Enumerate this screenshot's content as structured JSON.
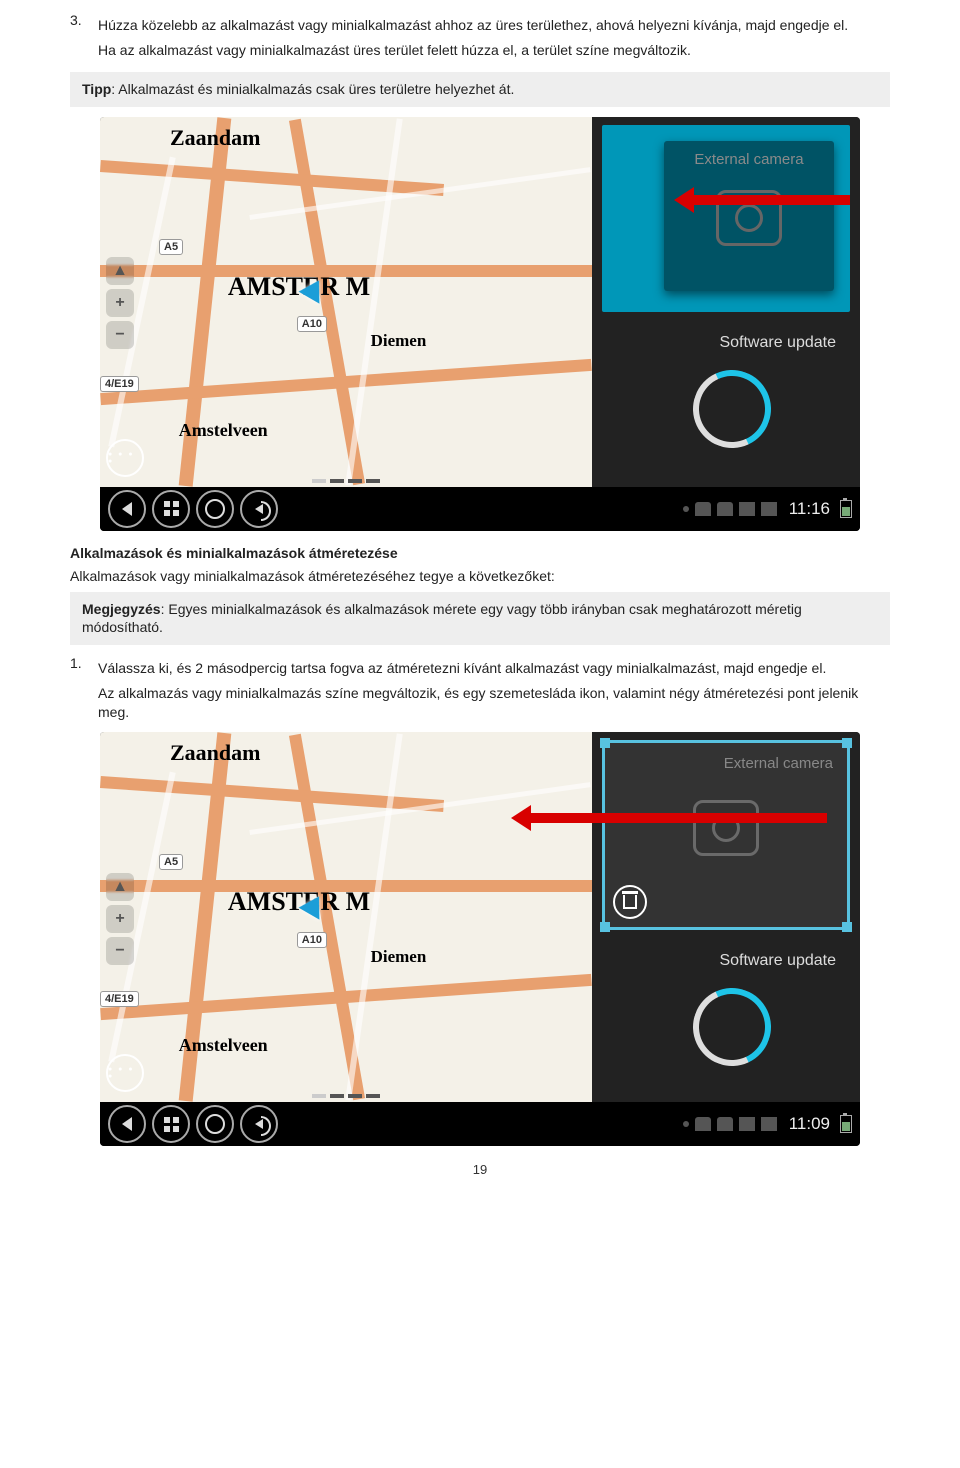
{
  "step3": {
    "num": "3.",
    "text": "Húzza közelebb az alkalmazást vagy minialkalmazást ahhoz az üres területhez, ahová helyezni kívánja, majd engedje el.",
    "sub": "Ha az alkalmazást vagy minialkalmazást üres terület felett húzza el, a terület színe megváltozik."
  },
  "tip": {
    "label": "Tipp",
    "text": ": Alkalmazást és minialkalmazás csak üres területre helyezhet át."
  },
  "section": {
    "title": "Alkalmazások és minialkalmazások átméretezése",
    "intro": "Alkalmazások vagy minialkalmazások átméretezéséhez tegye a következőket:"
  },
  "note": {
    "label": "Megjegyzés",
    "text": ": Egyes minialkalmazások és alkalmazások mérete egy vagy több irányban csak meghatározott méretig módosítható."
  },
  "step1b": {
    "num": "1.",
    "text": "Válassza ki, és 2 másodpercig tartsa fogva az átméretezni kívánt alkalmazást vagy minialkalmazást, majd engedje el.",
    "sub": "Az alkalmazás vagy minialkalmazás színe megváltozik, és egy szemetesláda ikon, valamint négy átméretezési pont jelenik meg."
  },
  "map": {
    "zaandam": "Zaandam",
    "amsterdam": "AMSTER     M",
    "diemen": "Diemen",
    "amstelveen": "Amstelveen",
    "a5": "A5",
    "a10": "A10",
    "a4e19": "4/E19"
  },
  "tiles": {
    "external_camera": "External camera",
    "software_update": "Software update"
  },
  "status": {
    "time1": "11:16",
    "time2": "11:09"
  },
  "pagenum": "19"
}
